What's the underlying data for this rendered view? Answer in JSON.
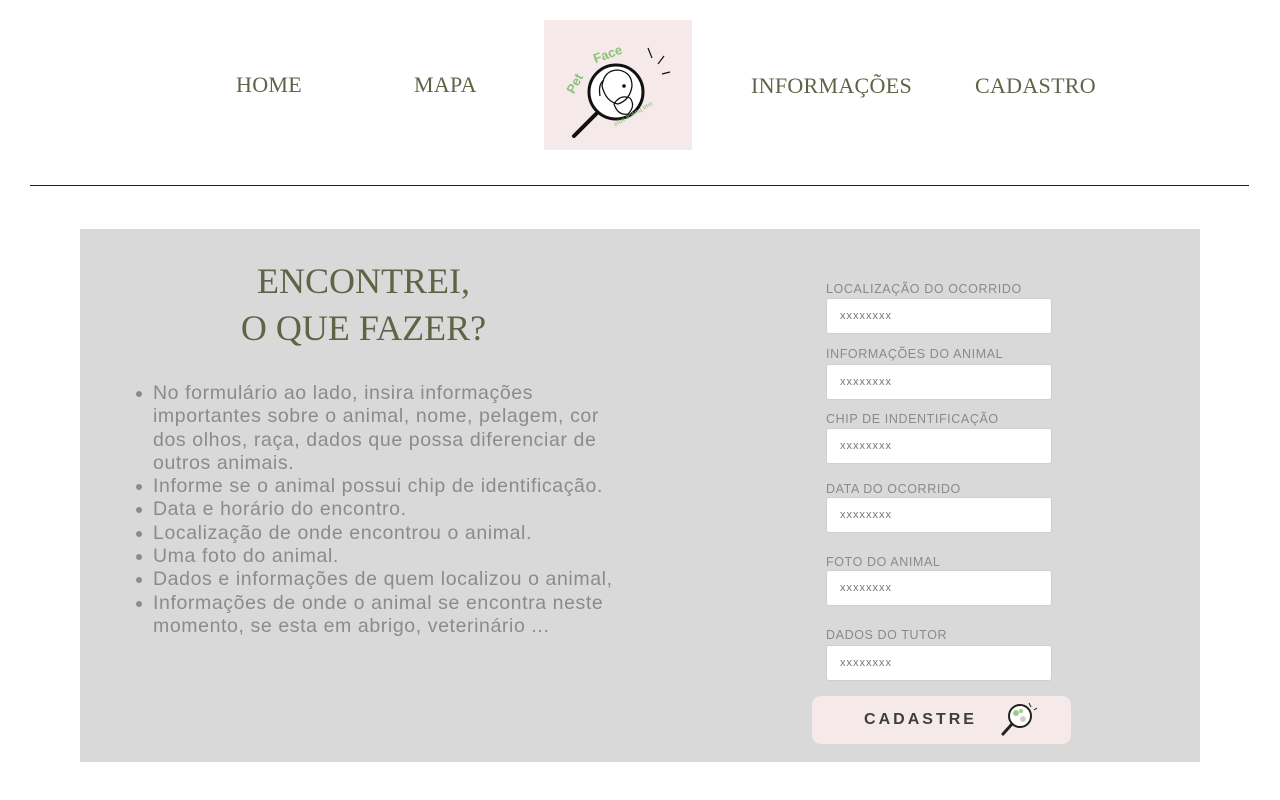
{
  "nav": {
    "home": "HOME",
    "mapa": "MAPA",
    "informacoes": "INFORMAÇÕES",
    "cadastro": "CADASTRO"
  },
  "logo": {
    "name": "Pet Face",
    "tagline": "sua busca aqui"
  },
  "intro": {
    "title_line1": "ENCONTREI,",
    "title_line2": "O QUE FAZER?",
    "items": [
      "No formulário ao lado, insira informações importantes sobre o animal, nome, pelagem, cor dos olhos, raça, dados que possa diferenciar de outros animais.",
      "Informe se o animal possui chip de identificação.",
      "Data e horário do encontro.",
      "Localização de onde encontrou o animal.",
      "Uma foto do animal.",
      "Dados e informações de quem localizou o animal,",
      "Informações de onde o animal se encontra neste momento, se esta em abrigo, veterinário ..."
    ]
  },
  "form": {
    "fields": [
      {
        "label": "LOCALIZAÇÃO DO OCORRIDO",
        "placeholder": "xxxxxxxx"
      },
      {
        "label": "INFORMAÇÕES DO ANIMAL",
        "placeholder": "xxxxxxxx"
      },
      {
        "label": "CHIP DE INDENTIFICAÇÃO",
        "placeholder": "xxxxxxxx"
      },
      {
        "label": "DATA DO OCORRIDO",
        "placeholder": "xxxxxxxx"
      },
      {
        "label": "FOTO DO ANIMAL",
        "placeholder": "xxxxxxxx"
      },
      {
        "label": "DADOS DO TUTOR",
        "placeholder": "xxxxxxxx"
      }
    ],
    "submit_label": "CADASTRE",
    "submit_icon": "magnifier-pet-icon"
  },
  "colors": {
    "accent_olive": "#5f6447",
    "logo_bg": "#f5e9ea",
    "panel_bg": "#d9d9d9",
    "logo_green": "#8bc47a"
  }
}
